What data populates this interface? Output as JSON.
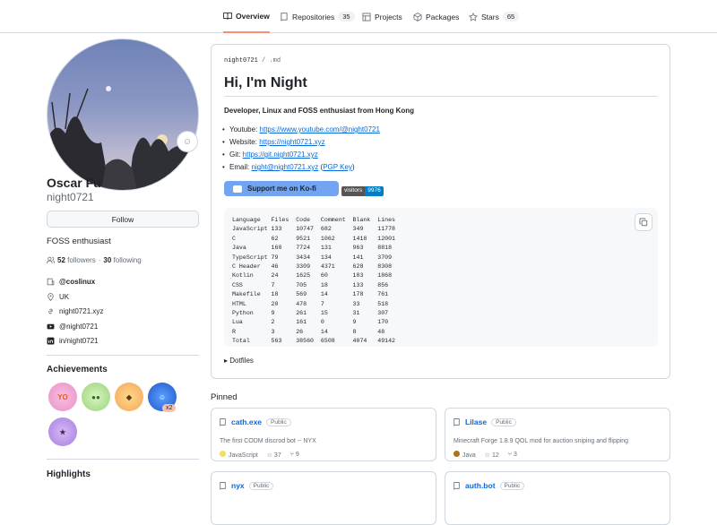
{
  "nav": {
    "overview": "Overview",
    "repositories": "Repositories",
    "repositories_count": "35",
    "projects": "Projects",
    "packages": "Packages",
    "stars": "Stars",
    "stars_count": "65"
  },
  "profile": {
    "name": "Oscar Fu",
    "login": "night0721",
    "follow_label": "Follow",
    "bio": "FOSS enthusiast",
    "followers": "52",
    "followers_label": "followers",
    "following": "30",
    "following_label": "following",
    "separator": "·",
    "org": "@coslinux",
    "location": "UK",
    "website": "night0721.xyz",
    "youtube": "@night0721",
    "linkedin": "in/night0721"
  },
  "achievements": {
    "title": "Achievements",
    "multiplier": "x2"
  },
  "highlights": {
    "title": "Highlights"
  },
  "readme": {
    "breadcrumb_user": "night0721",
    "breadcrumb_file": " / .md",
    "heading": "Hi, I'm Night",
    "subtitle": "Developer, Linux and FOSS enthusiast from Hong Kong",
    "links": [
      {
        "label": "Youtube: ",
        "url": "https://www.youtube.com/@night0721"
      },
      {
        "label": "Website: ",
        "url": "https://night0721.xyz"
      },
      {
        "label": "Git: ",
        "url": "https://git.night0721.xyz"
      },
      {
        "label": "Email: ",
        "url": "night@night0721.xyz",
        "extra_pre": " (",
        "extra": "PGP Key",
        "extra_post": ")"
      }
    ],
    "kofi_label": "Support me on Ko-fi",
    "visitors_label": "visitors",
    "visitors_count": "9976",
    "code": "Language   Files  Code   Comment  Blank  Lines\nJavaScript 133    10747  682      349    11778\nC          62     9521   1062     1418   12001\nJava       160    7724   131      963    8818\nTypeScript 79     3434   134      141    3709\nC Header   46     3309   4371     628    8308\nKotlin     24     1625   60       183    1868\nCSS        7      705    18       133    856\nMakefile   18     569    14       178    761\nHTML       20     478    7        33     518\nPython     9      261    15       31     307\nLua        2      161    0        9      170\nR          3      26     14       8      48\nTotal      563    38560  6508     4074   49142",
    "dotfiles": "Dotfiles"
  },
  "pinned": {
    "title": "Pinned",
    "public_label": "Public",
    "cards": [
      {
        "name": "cath.exe",
        "desc": "The first CODM discrod bot -- NYX",
        "lang": "JavaScript",
        "lang_color": "#f1e05a",
        "stars": "37",
        "forks": "9"
      },
      {
        "name": "Lilase",
        "desc": "Minecraft Forge 1.8.9 QOL mod for auction sniping and flipping",
        "lang": "Java",
        "lang_color": "#b07219",
        "stars": "12",
        "forks": "3"
      },
      {
        "name": "nyx",
        "desc": "",
        "lang": "",
        "lang_color": "",
        "stars": "",
        "forks": ""
      },
      {
        "name": "auth.bot",
        "desc": "",
        "lang": "",
        "lang_color": "",
        "stars": "",
        "forks": ""
      }
    ]
  }
}
